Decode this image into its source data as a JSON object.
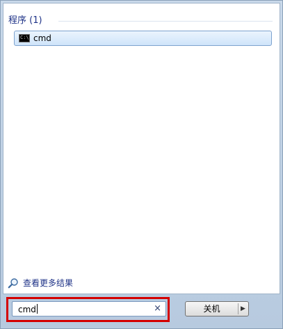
{
  "start_menu": {
    "section": {
      "title": "程序 (1)"
    },
    "results": [
      {
        "label": "cmd",
        "icon": "command-prompt-icon",
        "selected": true
      }
    ],
    "more_results": {
      "label": "查看更多结果",
      "icon": "search-icon"
    },
    "search": {
      "value": "cmd",
      "clear_icon": "×",
      "highlight_color": "#d40000"
    },
    "shutdown": {
      "label": "关机",
      "arrow": "▶"
    }
  }
}
